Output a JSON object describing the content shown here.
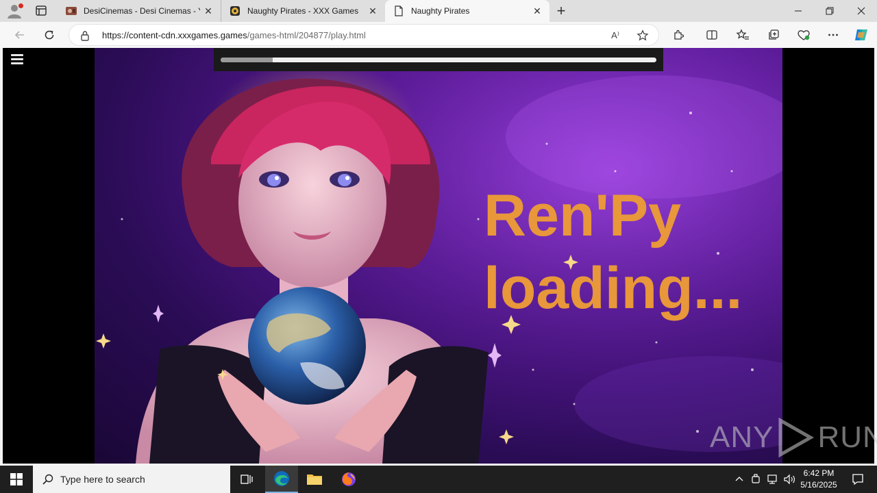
{
  "browser": {
    "tabs": [
      {
        "title": "DesiCinemas - Desi Cinemas - Yo",
        "close": "✕"
      },
      {
        "title": "Naughty Pirates - XXX Games",
        "close": "✕"
      },
      {
        "title": "Naughty Pirates",
        "close": "✕"
      }
    ],
    "new_tab": "+",
    "url_host": "https://content-cdn.xxxgames.games",
    "url_path": "/games-html/204877/play.html",
    "read_aloud": "A⁾"
  },
  "game": {
    "loading_line1": "Ren'Py",
    "loading_line2": "loading...",
    "progress": 0.12
  },
  "watermark": {
    "left": "ANY",
    "right": "RUN"
  },
  "taskbar": {
    "search_placeholder": "Type here to search",
    "time": "6:42 PM",
    "date": "5/16/2025"
  },
  "colors": {
    "accent_text": "#e8973a",
    "taskbar": "#1f1f1f",
    "edge_blue": "#0f6cbd"
  }
}
